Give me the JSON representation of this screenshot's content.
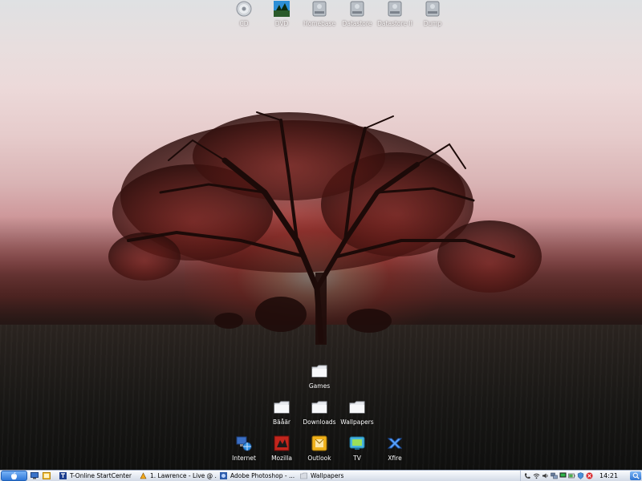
{
  "desktop": {
    "top_icons": [
      {
        "label": "CD",
        "icon": "cd-drive-icon"
      },
      {
        "label": "DVD",
        "icon": "dvd-drive-icon"
      },
      {
        "label": "Homebase",
        "icon": "hard-drive-icon"
      },
      {
        "label": "Datastore",
        "icon": "hard-drive-icon"
      },
      {
        "label": "Datastore II",
        "icon": "hard-drive-icon"
      },
      {
        "label": "Dump",
        "icon": "hard-drive-icon"
      }
    ],
    "folders": [
      {
        "label": "Games",
        "icon": "folder-icon"
      },
      {
        "label": "Bäåär",
        "icon": "folder-icon"
      },
      {
        "label": "Downloads",
        "icon": "folder-icon"
      },
      {
        "label": "Wallpapers",
        "icon": "folder-icon"
      }
    ],
    "apps": [
      {
        "label": "Internet",
        "icon": "network-globe-icon"
      },
      {
        "label": "Mozilla",
        "icon": "mozilla-icon"
      },
      {
        "label": "Outlook",
        "icon": "outlook-icon"
      },
      {
        "label": "TV",
        "icon": "tv-icon"
      },
      {
        "label": "Xfire",
        "icon": "xfire-icon"
      }
    ]
  },
  "taskbar": {
    "start_icon": "apple-logo-icon",
    "quicklaunch": [
      "show-desktop-icon",
      "explorer-icon"
    ],
    "tasks": [
      {
        "label": "T-Online StartCenter",
        "icon": "t-online-icon"
      },
      {
        "label": "1. Lawrence - Live @ ...",
        "icon": "winamp-icon"
      },
      {
        "label": "Adobe Photoshop - ...",
        "icon": "photoshop-icon"
      },
      {
        "label": "Wallpapers",
        "icon": "folder-icon"
      }
    ],
    "tray_icons": [
      "phone-icon",
      "wireless-icon",
      "volume-icon",
      "network-icon",
      "monitor-icon",
      "battery-icon",
      "shield-icon",
      "security-icon"
    ],
    "clock": "14:21",
    "search_icon": "search-icon"
  },
  "colors": {
    "sky_top": "#dfe1e3",
    "sunset_red": "#c15e5f",
    "ground_dark": "#141311",
    "taskbar_blue": "#2f78d8"
  }
}
